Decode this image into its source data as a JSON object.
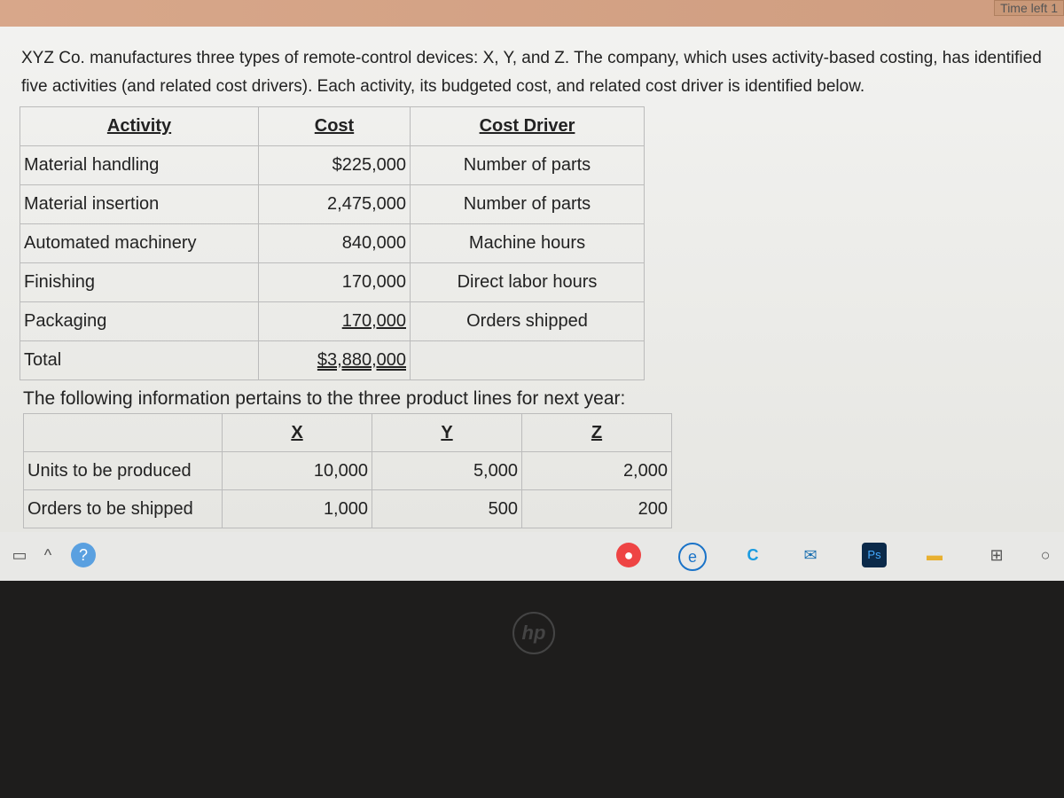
{
  "timer": {
    "label": "Time left 1"
  },
  "intro": "XYZ Co. manufactures three types of remote-control devices: X, Y, and Z. The company, which uses activity-based costing, has identified five activities (and related cost drivers). Each activity, its budgeted cost, and related cost driver is identified below.",
  "activities": {
    "headers": [
      "Activity",
      "Cost",
      "Cost Driver"
    ],
    "rows": [
      [
        "Material handling",
        "$225,000",
        "Number of parts"
      ],
      [
        "Material insertion",
        "2,475,000",
        "Number of parts"
      ],
      [
        "Automated machinery",
        "840,000",
        "Machine hours"
      ],
      [
        "Finishing",
        "170,000",
        "Direct labor hours"
      ],
      [
        "Packaging",
        "170,000",
        "Orders shipped"
      ],
      [
        "Total",
        "$3,880,000",
        ""
      ]
    ]
  },
  "pertains": "The following information pertains to the three product lines for next year:",
  "products": {
    "headers": [
      "",
      "X",
      "Y",
      "Z"
    ],
    "rows": [
      [
        "Units to be produced",
        "10,000",
        "5,000",
        "2,000"
      ],
      [
        "Orders to be shipped",
        "1,000",
        "500",
        "200"
      ]
    ]
  },
  "taskbar": {
    "icons": [
      "chrome-icon",
      "edge-legacy-icon",
      "edge-icon",
      "mail-icon",
      "photoshop-icon",
      "file-explorer-icon",
      "task-view-icon",
      "cortana-icon"
    ],
    "ps_label": "Ps"
  },
  "brand": "hp"
}
